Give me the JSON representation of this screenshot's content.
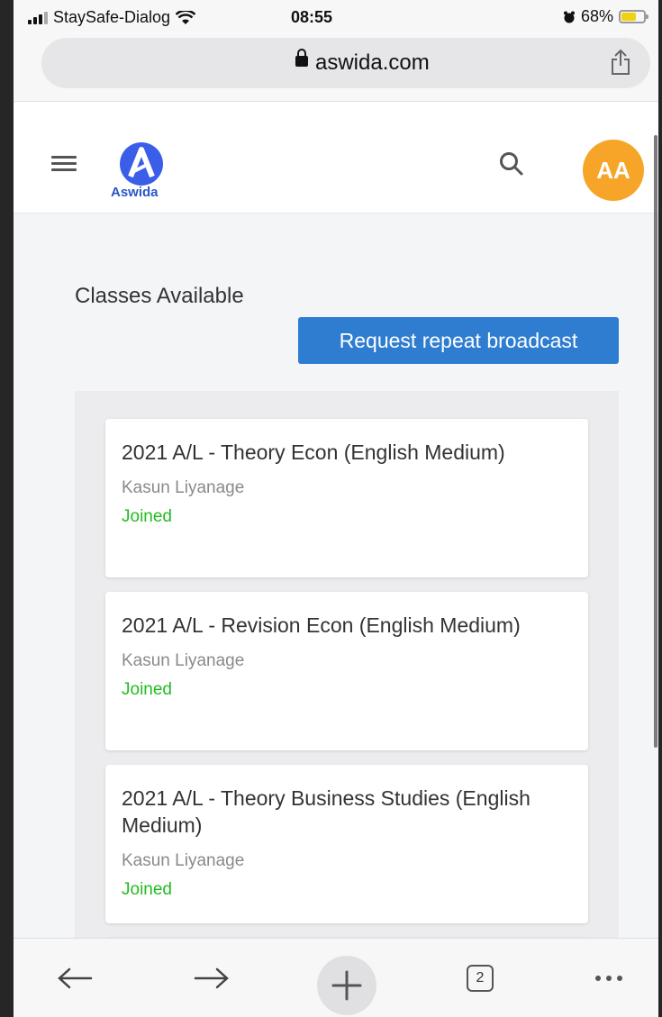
{
  "status_bar": {
    "carrier": "StaySafe-Dialog",
    "time": "08:55",
    "battery": "68%",
    "battery_level": 0.68,
    "icons": [
      "signal-icon",
      "wifi-icon",
      "alarm-icon",
      "battery-icon"
    ]
  },
  "browser": {
    "domain": "aswida.com",
    "tab_count": "2",
    "icons": [
      "lock-icon",
      "share-icon",
      "back-arrow-icon",
      "forward-arrow-icon",
      "plus-icon",
      "more-icon"
    ]
  },
  "header": {
    "logo_text": "Aswida",
    "avatar_initials": "AA",
    "icons": [
      "menu-icon",
      "aswida-logo-icon",
      "search-icon"
    ]
  },
  "main": {
    "title": "Classes Available",
    "request_button_label": "Request repeat broadcast",
    "classes": [
      {
        "title": "2021 A/L - Theory Econ (English Medium)",
        "teacher": "Kasun Liyanage",
        "status": "Joined"
      },
      {
        "title": "2021 A/L - Revision Econ (English Medium)",
        "teacher": "Kasun Liyanage",
        "status": "Joined"
      },
      {
        "title": "2021 A/L - Theory Business Studies (English Medium)",
        "teacher": "Kasun Liyanage",
        "status": "Joined"
      }
    ]
  },
  "colors": {
    "primary_button": "#2f7dd1",
    "avatar_bg": "#f7a528",
    "joined_text": "#22bb22",
    "logo_blue": "#2b56c8"
  }
}
